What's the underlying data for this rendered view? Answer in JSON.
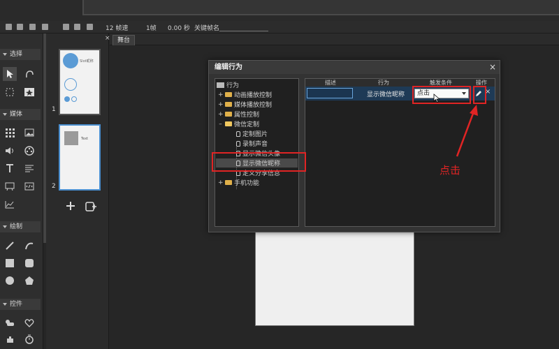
{
  "toolbar": {
    "fps": "12 帧速",
    "frames": "1帧",
    "seconds": "0.00 秒",
    "keyframe_label": "关键帧名"
  },
  "left_panel": {
    "sections": [
      "选择",
      "媒体",
      "绘制",
      "控件"
    ]
  },
  "pages": {
    "page1_num": "1",
    "page2_num": "2",
    "page1_text": "Slot昵称",
    "page2_text": "Text"
  },
  "stage": {
    "tab": "舞台"
  },
  "dialog": {
    "title": "编辑行为",
    "close": "×",
    "tree": {
      "root": "行为",
      "items": [
        "动画播放控制",
        "媒体播放控制",
        "属性控制",
        "微信定制"
      ],
      "sub_items": [
        "定制图片",
        "录制声音",
        "显示微信头像",
        "显示微信昵称",
        "定义分享信息"
      ],
      "last": "手机功能"
    },
    "grid": {
      "headers": [
        "描述",
        "行为",
        "触发条件",
        "操作"
      ],
      "row": {
        "description": "",
        "action": "显示微信昵称",
        "trigger": "点击"
      }
    }
  },
  "annotation": "点击",
  "colors": {
    "highlight": "#e02424",
    "selection": "#1e3a56",
    "accent": "#4a8fd0"
  }
}
